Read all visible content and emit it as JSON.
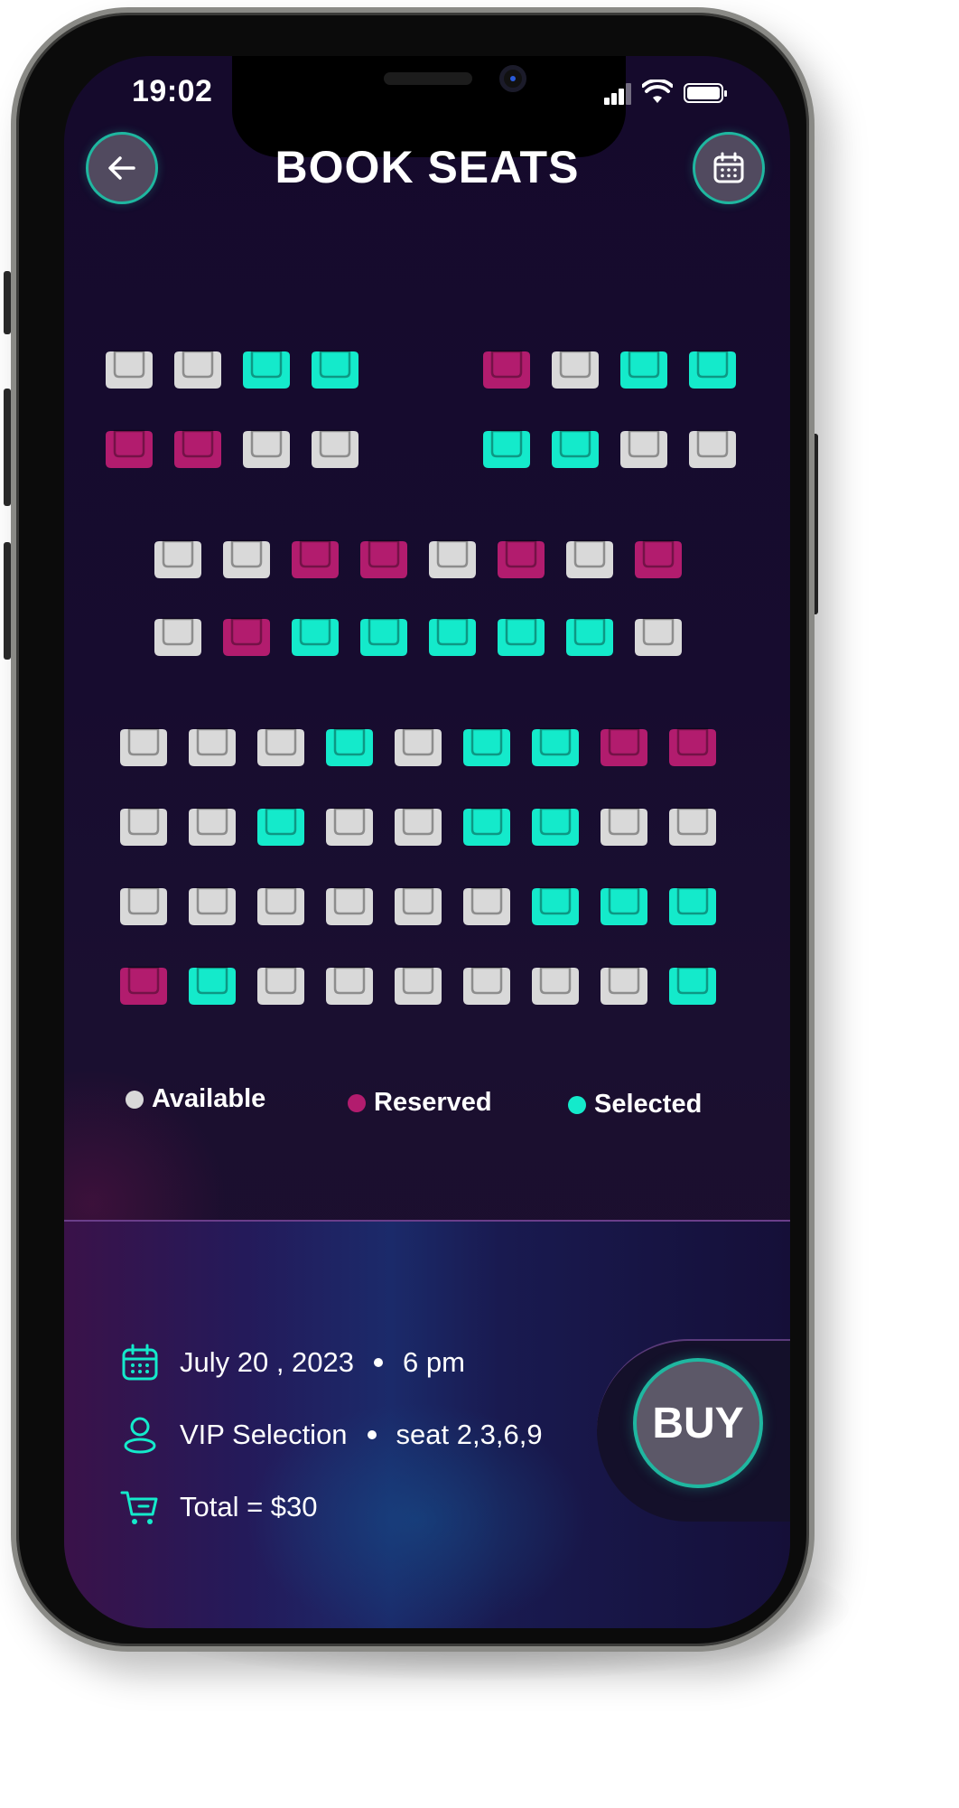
{
  "status_bar": {
    "time": "19:02"
  },
  "header": {
    "title": "BOOK SEATS",
    "back_icon": "arrow-left-icon",
    "calendar_icon": "calendar-icon"
  },
  "seat_map": {
    "rows": [
      [
        "available",
        "available",
        "selected",
        "selected",
        "reserved",
        "available",
        "selected",
        "selected"
      ],
      [
        "reserved",
        "reserved",
        "available",
        "available",
        "selected",
        "selected",
        "available",
        "available"
      ],
      [
        "available",
        "available",
        "reserved",
        "reserved",
        "available",
        "reserved",
        "available",
        "reserved"
      ],
      [
        "available",
        "reserved",
        "selected",
        "selected",
        "selected",
        "selected",
        "selected",
        "available"
      ],
      [
        "available",
        "available",
        "available",
        "selected",
        "available",
        "selected",
        "selected",
        "reserved",
        "reserved"
      ],
      [
        "available",
        "available",
        "selected",
        "available",
        "available",
        "selected",
        "selected",
        "available",
        "available"
      ],
      [
        "available",
        "available",
        "available",
        "available",
        "available",
        "available",
        "selected",
        "selected",
        "selected"
      ],
      [
        "reserved",
        "selected",
        "available",
        "available",
        "available",
        "available",
        "available",
        "available",
        "selected"
      ]
    ]
  },
  "legend": [
    {
      "label": "Available",
      "color": "#d9d9d9"
    },
    {
      "label": "Reserved",
      "color": "#b21c6e"
    },
    {
      "label": "Selected",
      "color": "#14eacb"
    }
  ],
  "booking": {
    "date": "July 20 , 2023",
    "time": "6 pm",
    "selection": "VIP Selection",
    "seats": "seat 2,3,6,9",
    "total": "Total  = $30",
    "buy_label": "BUY"
  },
  "colors": {
    "accent": "#14eacb",
    "reserved": "#b21c6e",
    "available": "#d9d9d9",
    "background": "#150a2c"
  }
}
